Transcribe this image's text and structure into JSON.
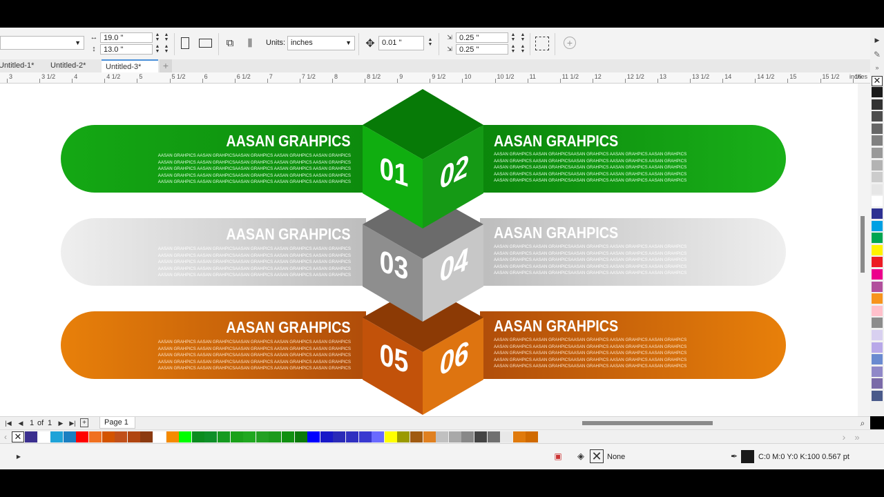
{
  "toolbar": {
    "width": "19.0 \"",
    "height": "13.0 \"",
    "units_label": "Units:",
    "units_value": "inches",
    "nudge": "0.01 \"",
    "dup_x": "0.25 \"",
    "dup_y": "0.25 \""
  },
  "tabs": [
    {
      "label": "Untitled-1*"
    },
    {
      "label": "Untitled-2*"
    },
    {
      "label": "Untitled-3*"
    }
  ],
  "ruler": {
    "labels": [
      "3",
      "3 1/2",
      "4",
      "4 1/2",
      "5",
      "5 1/2",
      "6",
      "6 1/2",
      "7",
      "7 1/2",
      "8",
      "8 1/2",
      "9",
      "9 1/2",
      "10",
      "10 1/2",
      "11",
      "11 1/2",
      "12",
      "12 1/2",
      "13",
      "13 1/2",
      "14",
      "14 1/2",
      "15",
      "15 1/2",
      "16"
    ],
    "unit": "inches"
  },
  "infographic": {
    "rows": [
      {
        "left_title": "AASAN GRAHPICS",
        "right_title": "AASAN GRAHPICS",
        "left_num": "01",
        "right_num": "02",
        "color": "#18a418"
      },
      {
        "left_title": "AASAN GRAHPICS",
        "right_title": "AASAN GRAHPICS",
        "left_num": "03",
        "right_num": "04",
        "color": "#d6d6d6"
      },
      {
        "left_title": "AASAN GRAHPICS",
        "right_title": "AASAN GRAHPICS",
        "left_num": "05",
        "right_num": "06",
        "color": "#e07a0c"
      }
    ],
    "body_text": "AASAN GRAHPICS AASAN GRAHPICSAASAN GRAHPICS AASAN GRAHPICS AASAN GRAHPICS\nAASAN GRAHPICS AASAN GRAHPICSAASAN GRAHPICS AASAN GRAHPICS AASAN GRAHPICS\nAASAN GRAHPICS AASAN GRAHPICSAASAN GRAHPICS AASAN GRAHPICS AASAN GRAHPICS\nAASAN GRAHPICS AASAN GRAHPICSAASAN GRAHPICS AASAN GRAHPICS AASAN GRAHPICS\nAASAN GRAHPICS AASAN GRAHPICSAASAN GRAHPICS AASAN GRAHPICS AASAN GRAHPICS"
  },
  "pagenav": {
    "current": "1",
    "of": "of",
    "total": "1",
    "page_tab": "Page 1"
  },
  "status": {
    "fill_label": "None",
    "outline_label": "C:0 M:0 Y:0 K:100  0.567 pt"
  },
  "colors": {
    "bottom_palette": [
      "#3b2f8f",
      "#ffffff",
      "#1ea3d8",
      "#1a7fc1",
      "#ff0000",
      "#f07020",
      "#d35400",
      "#c0501a",
      "#b04510",
      "#8b3a10",
      "#ffffff",
      "#f58a00",
      "#00ff00",
      "#0a8c1e",
      "#0e8f28",
      "#159a20",
      "#1aa11a",
      "#20a820",
      "#22a022",
      "#1b9a1b",
      "#119011",
      "#0a7a0a",
      "#0000ff",
      "#1818c8",
      "#2a2ab8",
      "#3030c0",
      "#3838d0",
      "#6a6aff",
      "#ffff00",
      "#9a9a00",
      "#a05a10",
      "#e08020",
      "#c0c0c0",
      "#a8a8a8",
      "#888888",
      "#444444",
      "#707070",
      "#e8e8e8",
      "#e07a0c",
      "#d06a00"
    ],
    "right_palette": [
      "#1a1a1a",
      "#333333",
      "#4d4d4d",
      "#666666",
      "#808080",
      "#999999",
      "#b3b3b3",
      "#cccccc",
      "#e6e6e6",
      "#ffffff",
      "#2e3192",
      "#00a0e3",
      "#00a651",
      "#fff200",
      "#ed1c24",
      "#ec008c",
      "#b14f9c",
      "#f7941d",
      "#ffc0cb",
      "#8c8c8c",
      "#d8d0f0",
      "#b8a8e8",
      "#6a8ad0",
      "#9088c8",
      "#7a6aa8",
      "#4a5a8a"
    ]
  }
}
